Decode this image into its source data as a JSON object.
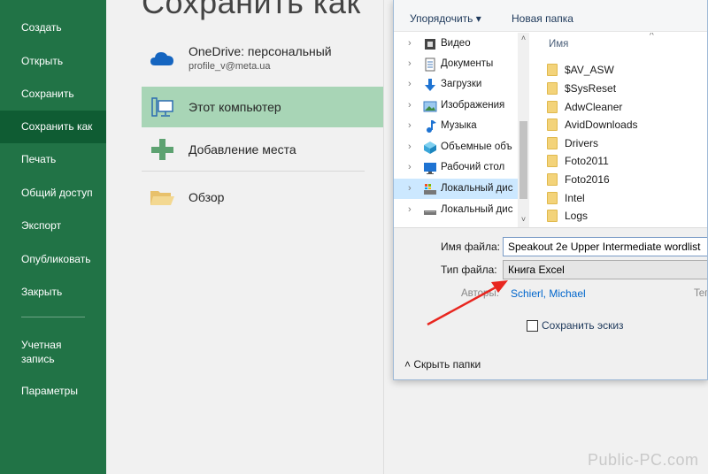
{
  "nav": {
    "items": [
      {
        "label": "Создать"
      },
      {
        "label": "Открыть"
      },
      {
        "label": "Сохранить"
      },
      {
        "label": "Сохранить как"
      },
      {
        "label": "Печать"
      },
      {
        "label": "Общий доступ"
      },
      {
        "label": "Экспорт"
      },
      {
        "label": "Опубликовать"
      },
      {
        "label": "Закрыть"
      },
      {
        "label": "Учетная запись"
      },
      {
        "label": "Параметры"
      }
    ],
    "active": "Сохранить как"
  },
  "middle": {
    "heading": "Сохранить как",
    "locations": [
      {
        "title": "OneDrive: персональный",
        "subtitle": "profile_v@meta.ua",
        "icon": "cloud-icon"
      },
      {
        "title": "Этот компьютер",
        "icon": "computer-icon",
        "selected": true
      },
      {
        "title": "Добавление места",
        "icon": "plus-icon"
      },
      {
        "title": "Обзор",
        "icon": "folder-open-icon"
      }
    ]
  },
  "dialog": {
    "toolbar": {
      "organize": "Упорядочить ▾",
      "new_folder": "Новая папка"
    },
    "tree": [
      {
        "label": "Видео",
        "icon": "video-icon"
      },
      {
        "label": "Документы",
        "icon": "documents-icon"
      },
      {
        "label": "Загрузки",
        "icon": "download-icon"
      },
      {
        "label": "Изображения",
        "icon": "pictures-icon"
      },
      {
        "label": "Музыка",
        "icon": "music-icon"
      },
      {
        "label": "Объемные объ",
        "icon": "3d-objects-icon"
      },
      {
        "label": "Рабочий стол",
        "icon": "desktop-icon"
      },
      {
        "label": "Локальный дис",
        "icon": "drive-icon",
        "selected": true
      },
      {
        "label": "Локальный дис",
        "icon": "drive-icon"
      }
    ],
    "files_header": "Имя",
    "files": [
      "$AV_ASW",
      "$SysReset",
      "AdwCleaner",
      "AvidDownloads",
      "Drivers",
      "Foto2011",
      "Foto2016",
      "Intel",
      "Logs"
    ],
    "form": {
      "filename_label": "Имя файла:",
      "filename_value": "Speakout 2e Upper Intermediate wordlist",
      "filetype_label": "Тип файла:",
      "filetype_value": "Книга Excel",
      "authors_label": "Авторы:",
      "authors_value": "Schierl, Michael",
      "tags_label": "Teг",
      "thumbnail_label": "Сохранить эскиз",
      "hide_folders": "˄  Скрыть папки"
    }
  },
  "watermark": "Public-PC.com",
  "colors": {
    "nav_bg": "#217346",
    "nav_active": "#0f5c33",
    "selected_location": "#a8d5b6",
    "arrow": "#e8261f"
  }
}
